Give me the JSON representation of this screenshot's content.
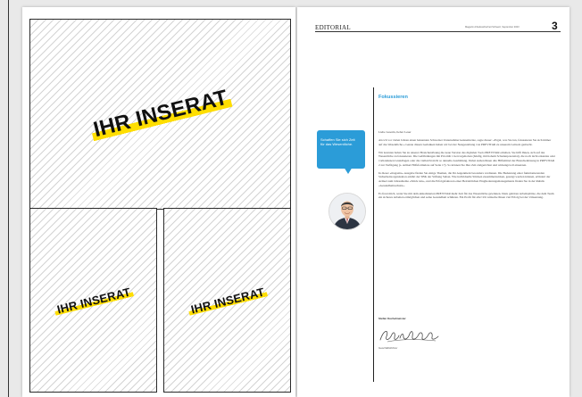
{
  "ads": {
    "big_label": "IHR INSERAT",
    "small_left_label": "IHR INSERAT",
    "small_right_label": "IHR INSERAT"
  },
  "header": {
    "section": "EDITORIAL",
    "meta": "Magazin Arbeitssicherheit Schweiz, September 2023",
    "page_number": "3"
  },
  "bubble": {
    "text": "Schaffen Sie sich Zeit für das Wesentliche."
  },
  "article": {
    "title": "Fokussieren",
    "salutation": "Liebe Leserin, lieber Leser",
    "paragraphs": [
      "Als ich vor vielen Jahren einen bekannten Schweizer Unternehmer kennenlernte, sagte dieser: «Ergal, was Sie tun, fokussieren Sie sich immer auf das Wesentliche.» Genau diesen Gedanken haben wir bei der Neugestaltung von PREVITAR zu unserem Leitsatz gemacht.",
      "Wir konnten haben Sie zu unserer Branchenlösung die neue Version des digitalen Tools PREVITAR erhalten. Sie hilft Ihnen, sich auf das Wesentliche zu fokussieren. Die Gefährdungen mit Priorität 1 hervorgehoben (häufig, mit hohem Schadenpotenzial), die noch nicht erkannte oder vorhandenen Grundlagen oder die vielleicht nicht so aktuelle Ausbildung. Dabei stehen Ihnen alle Hilfsmittel der Branchenlösung in PREVITAR 2 zur Verfügung (s. Artikel Hilfsformulare auf Seite 17). So können Sie Ihre Zeit zielgerichtet und wirkungsvoll einsetzen.",
      "In dieser «magazin»-Ausgabe finden Sie einige Themen, die Ihr Augenmerk besonders verdienen. Die Bedeutung einer funktionierenden Sicherheitsorganisation erklärt der SBK der Stiftung Suban. Wie individuelle Stücken zusammenwirken, gezeigt werden können, erläutert der Artikel zum Jahresthema «Stück tuts», und die Erfolgsfaktoren einer Betrieblichen Eingliederungsmanagements finden Sie in der Rubrik «Gesundheitsschutz».",
      "Es freut mich, wenn Sie mit dem aktualisierten PREVITAR mehr Zeit für das Wesentliche gewinnen. Dazu gehören Arbeitsplätze, die dem Team ein sicheres Arbeiten ermöglichen und seine Gesundheit schützen. Ein Profit für alle! Ich wünsche Ihnen viel Erfolg bei der Umsetzung."
    ],
    "signature_name": "Stefan Kuchelmeister",
    "signature_role": "Geschäftsführer"
  },
  "colors": {
    "accent_blue": "#2b9cd8",
    "ad_highlight": "#ffde00"
  }
}
